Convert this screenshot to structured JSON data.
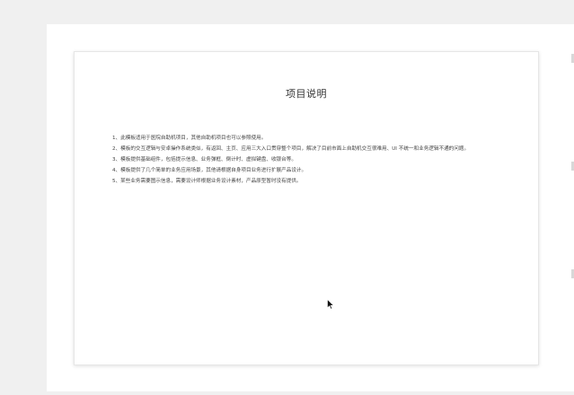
{
  "doc": {
    "title": "项目说明",
    "items": [
      "1、此模板适用于医院自助机项目，其他自助机项目也可以参照使用。",
      "2、模板的交互逻辑与安卓操作系统类似，有返回、主页、应用三大入口贯穿整个项目，解决了目前市面上自助机交互很难用、UI 不统一和业务逻辑不通的问题。",
      "3、模板提供基础组件，包括提示信息、业务弹框、倒计时、虚拟键盘、收银台等。",
      "4、模板提供了几个简单的业务应用场景，其他请根据自身项目业务进行扩展产品设计。",
      "5、某些业务需要图示信息，需要设计师根据业务设计素材，产品原型暂时没有提供。"
    ]
  },
  "icons": {
    "cursor": "mouse-pointer-icon"
  }
}
